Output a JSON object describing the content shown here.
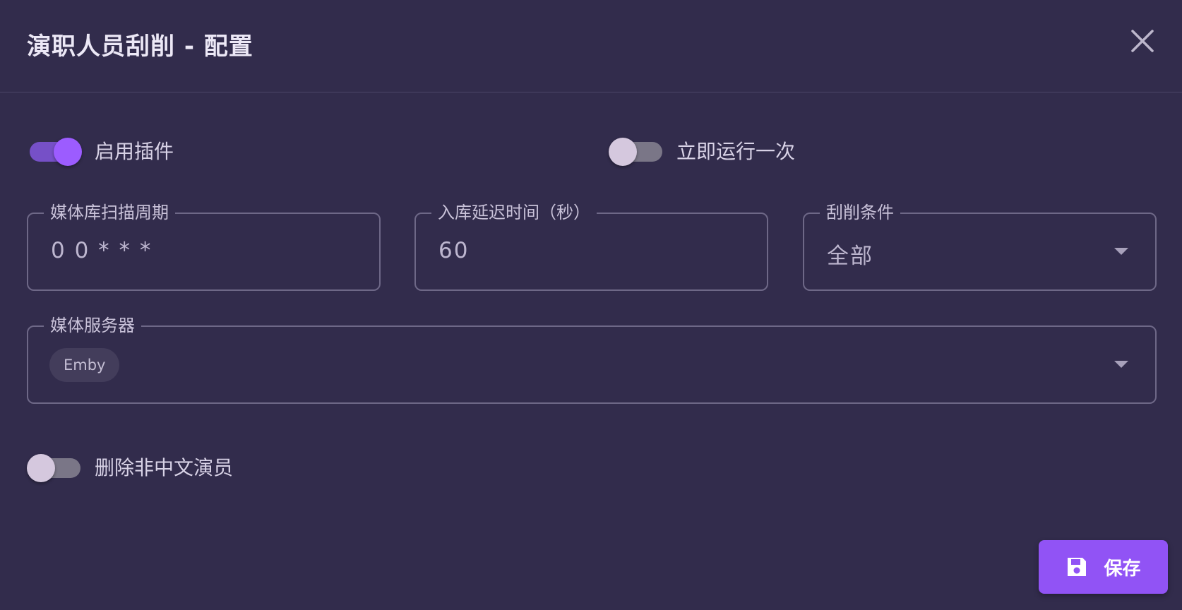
{
  "dialog": {
    "title": "演职人员刮削 - 配置"
  },
  "switches": {
    "enable_plugin": {
      "label": "启用插件",
      "on": true
    },
    "run_once": {
      "label": "立即运行一次",
      "on": false
    },
    "delete_non_chinese": {
      "label": "删除非中文演员",
      "on": false
    }
  },
  "fields": {
    "scan_cycle": {
      "label": "媒体库扫描周期",
      "value": "0 0 * * *"
    },
    "delay": {
      "label": "入库延迟时间（秒）",
      "value": "60"
    },
    "condition": {
      "label": "刮削条件",
      "value": "全部"
    },
    "media_server": {
      "label": "媒体服务器",
      "chips": [
        "Emby"
      ]
    }
  },
  "actions": {
    "save_label": "保存"
  },
  "colors": {
    "background": "#322c4c",
    "accent": "#9153f5",
    "switch_on": "#9c5cff"
  },
  "icons": {
    "close": "close-icon",
    "save": "floppy-disk-icon",
    "dropdown": "caret-down-icon"
  }
}
